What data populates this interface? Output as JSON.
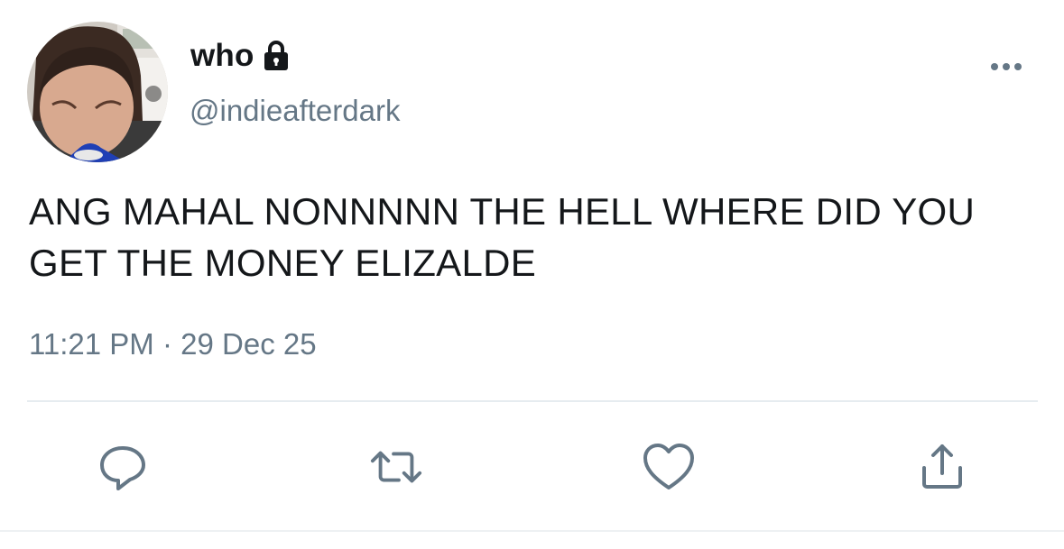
{
  "author": {
    "display_name": "who",
    "handle": "@indieafterdark",
    "protected_icon": "lock-icon",
    "avatar": "profile-photo"
  },
  "tweet": {
    "text": "ANG MAHAL NONNNNN THE HELL WHERE DID YOU GET THE MONEY ELIZALDE",
    "time": "11:21 PM",
    "separator": " · ",
    "date": "29 Dec 25"
  },
  "actions": [
    {
      "name": "reply",
      "icon": "comment-icon"
    },
    {
      "name": "retweet",
      "icon": "retweet-icon"
    },
    {
      "name": "like",
      "icon": "heart-icon"
    },
    {
      "name": "share",
      "icon": "share-icon"
    }
  ],
  "menu_icon": "more-options-icon",
  "colors": {
    "text": "#14171a",
    "secondary": "#657786",
    "divider": "#e6ecf0",
    "background": "#ffffff"
  }
}
